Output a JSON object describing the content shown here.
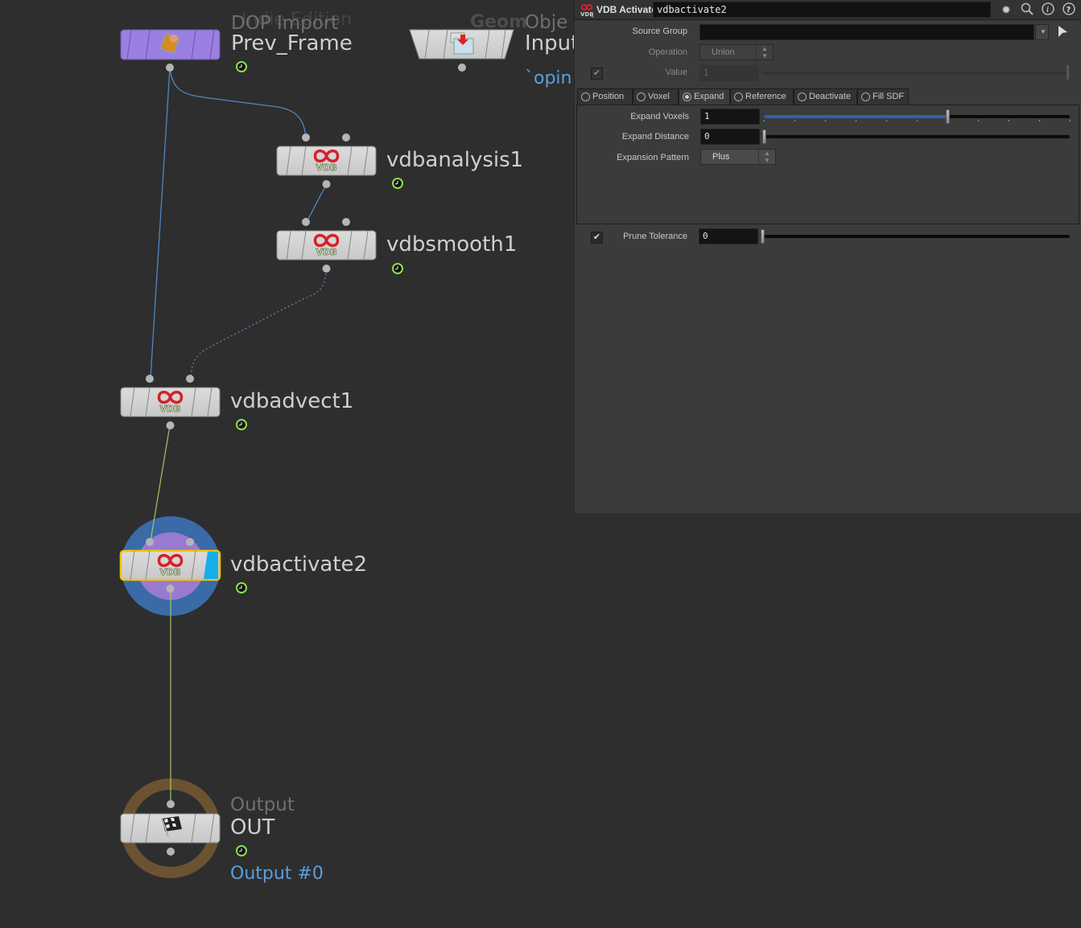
{
  "network": {
    "watermark": "Indie Edition",
    "nodes": [
      {
        "id": "prev_frame",
        "type_label": "DOP Import",
        "name": "Prev_Frame",
        "icon": "dop-import-icon",
        "color": "#9b7fe0"
      },
      {
        "id": "input",
        "type_label": "Geometry Object",
        "name": "Input",
        "extra": "`opin",
        "icon": "object-merge-icon"
      },
      {
        "id": "vdbanalysis1",
        "name": "vdbanalysis1",
        "icon": "vdb-icon"
      },
      {
        "id": "vdbsmooth1",
        "name": "vdbsmooth1",
        "icon": "vdb-icon"
      },
      {
        "id": "vdbadvect1",
        "name": "vdbadvect1",
        "icon": "vdb-icon"
      },
      {
        "id": "vdbactivate2",
        "name": "vdbactivate2",
        "icon": "vdb-icon",
        "selected": true,
        "display_flag": true,
        "render_flag": true
      },
      {
        "id": "out",
        "type_label": "Output",
        "name": "OUT",
        "extra": "Output #0",
        "icon": "checkered-flag-icon"
      }
    ],
    "vdb_badge": "VDB"
  },
  "params": {
    "title": {
      "op_type": "VDB Activate",
      "node_name": "vdbactivate2"
    },
    "source_group": {
      "label": "Source Group",
      "value": ""
    },
    "operation": {
      "label": "Operation",
      "value": "Union"
    },
    "value": {
      "label": "Value",
      "value": "1"
    },
    "tabs": [
      {
        "label": "Position",
        "active": false
      },
      {
        "label": "Voxel",
        "active": false
      },
      {
        "label": "Expand",
        "active": true
      },
      {
        "label": "Reference",
        "active": false
      },
      {
        "label": "Deactivate",
        "active": false
      },
      {
        "label": "Fill SDF",
        "active": false
      }
    ],
    "expand_voxels": {
      "label": "Expand Voxels",
      "value": "1",
      "slider_fraction": 0.6
    },
    "expand_distance": {
      "label": "Expand Distance",
      "value": "0",
      "slider_fraction": 0.0
    },
    "expansion_pattern": {
      "label": "Expansion Pattern",
      "value": "Plus"
    },
    "prune_tolerance": {
      "label": "Prune Tolerance",
      "value": "0",
      "enabled": true,
      "slider_fraction": 0.0
    }
  },
  "colors": {
    "background": "#2e2e2e",
    "wire": "#4f87c4",
    "wire_selected": "#a5c46a",
    "vdb_red": "#d6202a",
    "selection_outline": "#f1c40f",
    "display_flag": "#15aeea",
    "dop_purple": "#9b7fe0",
    "output_ring": "#6b5331",
    "active_ring_outer": "#3a6aa8",
    "active_ring_inner": "#9a7ad0",
    "link_blue": "#5a9fdc"
  }
}
